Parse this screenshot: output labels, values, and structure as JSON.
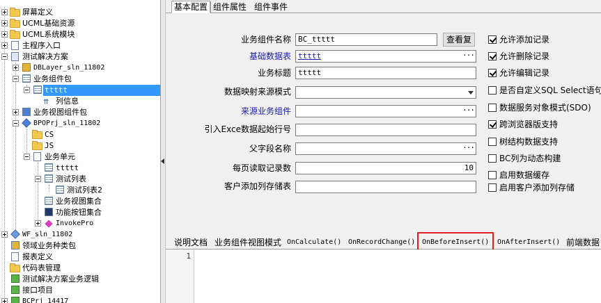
{
  "tree": {
    "nodes": [
      {
        "label": "屏幕定义",
        "icon": "folder-icon"
      },
      {
        "label": "UCML基础资源",
        "icon": "folder-icon"
      },
      {
        "label": "UCML系统模块",
        "icon": "folder-icon"
      },
      {
        "label": "主程序入口",
        "icon": "document-icon"
      },
      {
        "label": "测试解决方案",
        "icon": "solution-icon"
      },
      {
        "label": "DBLayer_sln_11802",
        "icon": "project-icon"
      },
      {
        "label": "业务组件包",
        "icon": "component-package-icon"
      },
      {
        "label": "ttttt",
        "icon": "grid-icon"
      },
      {
        "label": "列信息",
        "icon": "columns-icon"
      },
      {
        "label": "业务视图组件包",
        "icon": "component-package-icon"
      },
      {
        "label": "BPOPrj_sln_11802",
        "icon": "project-icon"
      },
      {
        "label": "CS",
        "icon": "folder-icon"
      },
      {
        "label": "JS",
        "icon": "folder-icon"
      },
      {
        "label": "业务单元",
        "icon": "unit-icon"
      },
      {
        "label": "ttttt",
        "icon": "grid-icon"
      },
      {
        "label": "测试列表",
        "icon": "grid-icon"
      },
      {
        "label": "测试列表2",
        "icon": "grid-icon"
      },
      {
        "label": "业务视图集合",
        "icon": "grid-icon"
      },
      {
        "label": "功能按钮集合",
        "icon": "button-set-icon"
      },
      {
        "label": "InvokePro",
        "icon": "diamond-icon"
      },
      {
        "label": "WF_sln_11802",
        "icon": "project-icon"
      },
      {
        "label": "领域业务种类包",
        "icon": "package-icon"
      },
      {
        "label": "报表定义",
        "icon": "document-icon"
      },
      {
        "label": "代码表管理",
        "icon": "folder-icon"
      },
      {
        "label": "测试解决方案业务逻辑",
        "icon": "code-icon"
      },
      {
        "label": "接口项目",
        "icon": "code-icon"
      },
      {
        "label": "BCPrj_14417",
        "icon": "project-icon"
      }
    ]
  },
  "tabs": [
    "基本配置",
    "组件属性",
    "组件事件"
  ],
  "form": {
    "name_label": "业务组件名称",
    "name_value": "BC_ttttt",
    "view_button": "查看复",
    "table_label": "基础数据表",
    "table_value": "ttttt",
    "title_label": "业务标题",
    "title_value": "ttttt",
    "source_mode_label": "数据映射来源模式",
    "source_comp_label": "来源业务组件",
    "excel_row_label": "引入Exce数据起始行号",
    "parent_field_label": "父字段名称",
    "page_size_label": "每页读取记录数",
    "page_size_value": "10",
    "client_col_label": "客户添加列存储表",
    "ellipsis": "···"
  },
  "options": [
    {
      "label": "允许添加记录",
      "checked": true
    },
    {
      "label": "允许删除记录",
      "checked": true
    },
    {
      "label": "允许编辑记录",
      "checked": true
    },
    {
      "label": "是否自定义SQL Select语句",
      "checked": false
    },
    {
      "label": "数据服务对象模式(SDO)",
      "checked": false
    },
    {
      "label": "跨浏览器版支持",
      "checked": true
    },
    {
      "label": "树结构数据支持",
      "checked": false
    },
    {
      "label": "BC列为动态构建",
      "checked": false
    },
    {
      "label": "启用数据缓存",
      "checked": false
    },
    {
      "label": "启用客户添加列存储",
      "checked": false
    }
  ],
  "event_tabs": [
    "说明文档",
    "业务组件视图模式",
    "OnCalculate()",
    "OnRecordChange()",
    "OnBeforeInsert()",
    "OnAfterInsert()",
    "前端数据"
  ],
  "editor": {
    "line_number": "1"
  }
}
